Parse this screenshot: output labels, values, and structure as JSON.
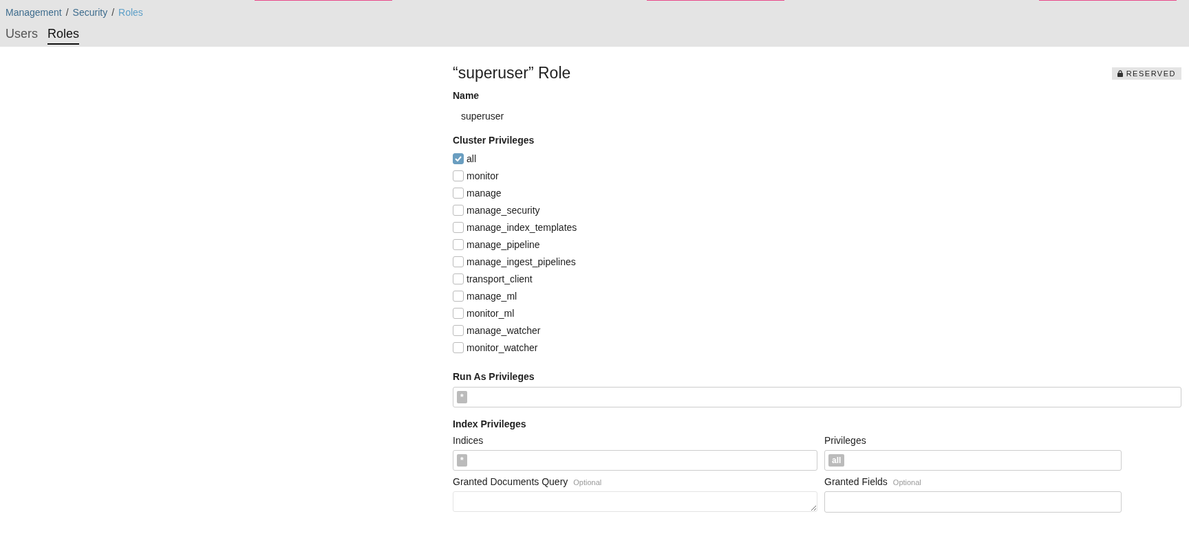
{
  "breadcrumbs": [
    {
      "label": "Management",
      "current": false,
      "separator": "/"
    },
    {
      "label": "Security",
      "current": false,
      "separator": "/"
    },
    {
      "label": "Roles",
      "current": true
    }
  ],
  "tabs": [
    {
      "label": "Users",
      "selected": false
    },
    {
      "label": "Roles",
      "selected": true
    }
  ],
  "title": "“superuser” Role",
  "badge": {
    "label": "RESERVED"
  },
  "name": {
    "label": "Name",
    "value": "superuser"
  },
  "cluster_privileges": {
    "label": "Cluster Privileges",
    "items": [
      {
        "label": "all",
        "checked": true
      },
      {
        "label": "monitor",
        "checked": false
      },
      {
        "label": "manage",
        "checked": false
      },
      {
        "label": "manage_security",
        "checked": false
      },
      {
        "label": "manage_index_templates",
        "checked": false
      },
      {
        "label": "manage_pipeline",
        "checked": false
      },
      {
        "label": "manage_ingest_pipelines",
        "checked": false
      },
      {
        "label": "transport_client",
        "checked": false
      },
      {
        "label": "manage_ml",
        "checked": false
      },
      {
        "label": "monitor_ml",
        "checked": false
      },
      {
        "label": "manage_watcher",
        "checked": false
      },
      {
        "label": "monitor_watcher",
        "checked": false
      }
    ]
  },
  "run_as": {
    "label": "Run As Privileges",
    "tags": [
      "*"
    ]
  },
  "index_privileges": {
    "label": "Index Privileges",
    "indices": {
      "label": "Indices",
      "tags": [
        "*"
      ]
    },
    "privileges": {
      "label": "Privileges",
      "tags": [
        "all"
      ]
    },
    "query": {
      "label": "Granted Documents Query",
      "hint": "Optional"
    },
    "fields": {
      "label": "Granted Fields",
      "hint": "Optional"
    }
  }
}
